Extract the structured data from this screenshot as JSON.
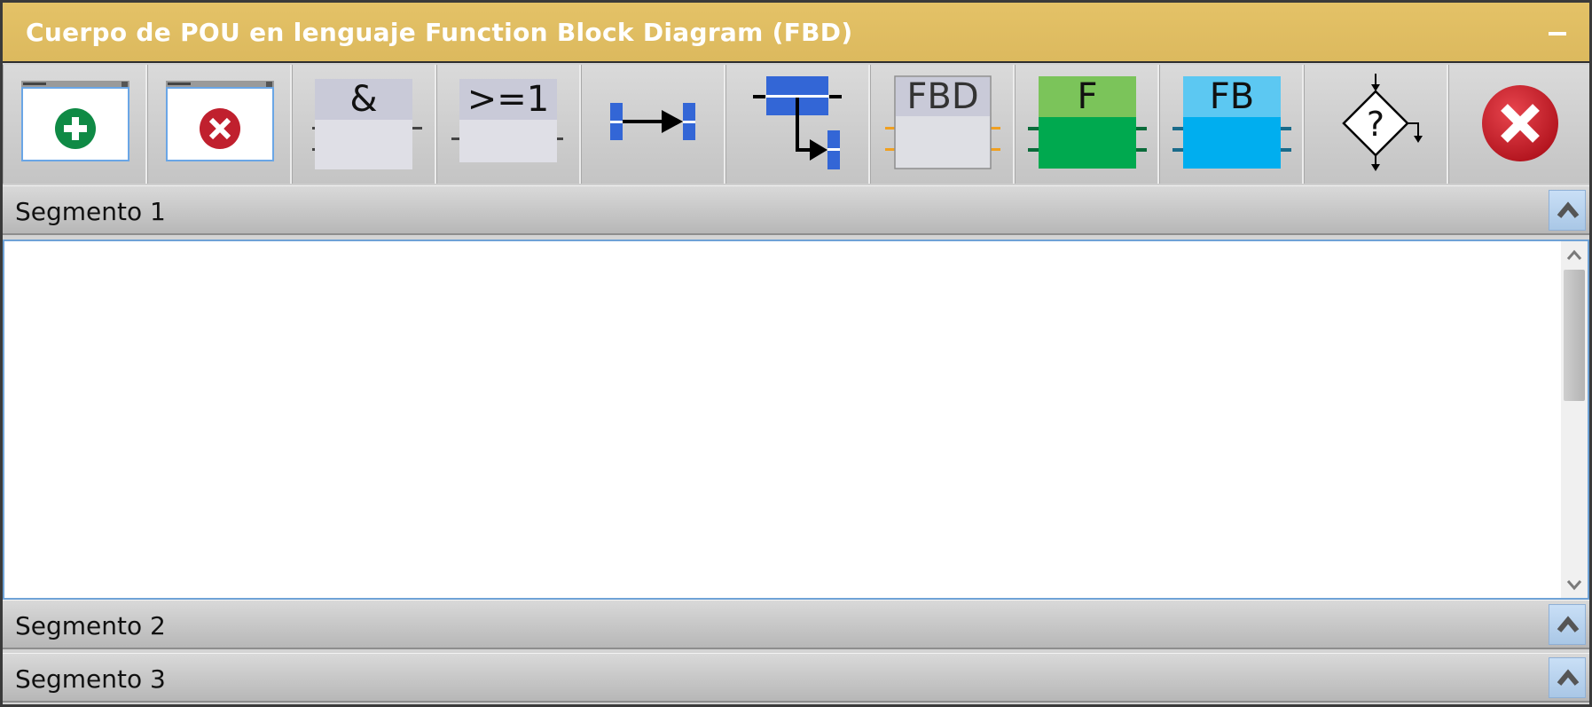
{
  "window": {
    "title": "Cuerpo de POU en lenguaje Function Block Diagram (FBD)",
    "minimize_icon": "minimize-icon",
    "accent_color": "#e0bd62"
  },
  "toolbar": {
    "tools": [
      {
        "id": "add-network",
        "icon": "add-network-icon"
      },
      {
        "id": "delete-network",
        "icon": "delete-network-icon"
      },
      {
        "id": "and-block",
        "icon": "and-gate-icon",
        "label": "&"
      },
      {
        "id": "or-block",
        "icon": "or-gate-icon",
        "label": ">=1"
      },
      {
        "id": "assignment",
        "icon": "assignment-connection-icon"
      },
      {
        "id": "branch",
        "icon": "branch-connection-icon"
      },
      {
        "id": "fbd-block",
        "icon": "fbd-block-icon",
        "label": "FBD"
      },
      {
        "id": "function-block",
        "icon": "function-icon",
        "label": "F"
      },
      {
        "id": "fb-instance",
        "icon": "function-block-icon",
        "label": "FB"
      },
      {
        "id": "conditional-jump",
        "icon": "conditional-jump-icon",
        "label": "?"
      },
      {
        "id": "close",
        "icon": "close-icon"
      }
    ]
  },
  "segments": [
    {
      "label": "Segmento 1",
      "expanded": true
    },
    {
      "label": "Segmento 2",
      "expanded": false
    },
    {
      "label": "Segmento 3",
      "expanded": false
    }
  ],
  "colors": {
    "add_green": "#0f8a45",
    "delete_red": "#c0202e",
    "function_green": "#00a94f",
    "function_block_blue": "#00aeef",
    "wire_blue": "#3366d6",
    "pin_orange": "#f0a020",
    "close_red": "#c81e28"
  }
}
